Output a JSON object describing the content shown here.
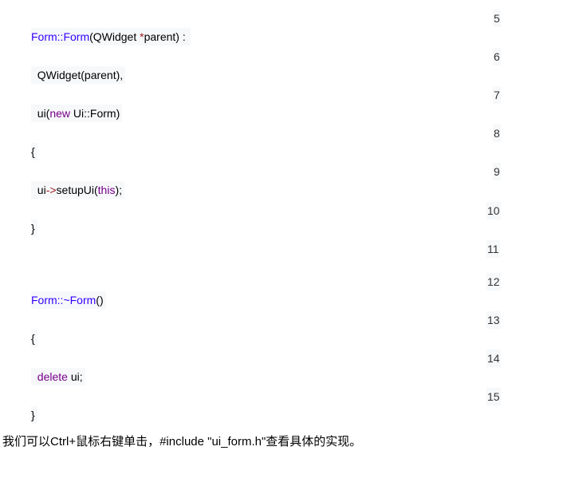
{
  "line_numbers": [
    "5",
    "6",
    "7",
    "8",
    "9",
    "10",
    "11",
    "12",
    "13",
    "14",
    "15"
  ],
  "code": {
    "l1": {
      "a": "Form::Form",
      "b": "(QWidget ",
      "c": "*",
      "d": "parent) :"
    },
    "l2": "  QWidget(parent),",
    "l3": {
      "a": "  ui(",
      "b": "new",
      "c": " Ui::Form)"
    },
    "l4": "{",
    "l5": {
      "a": "  ui",
      "b": "->",
      "c": "setupUi(",
      "d": "this",
      "e": ");"
    },
    "l6": "}",
    "l7": {
      "a": "Form::~Form",
      "b": "()"
    },
    "l8": "{",
    "l9": {
      "a": "  ",
      "b": "delete",
      "c": " ui;"
    },
    "l10": "}"
  },
  "note": "我们可以Ctrl+鼠标右键单击，#include \"ui_form.h\"查看具体的实现。"
}
